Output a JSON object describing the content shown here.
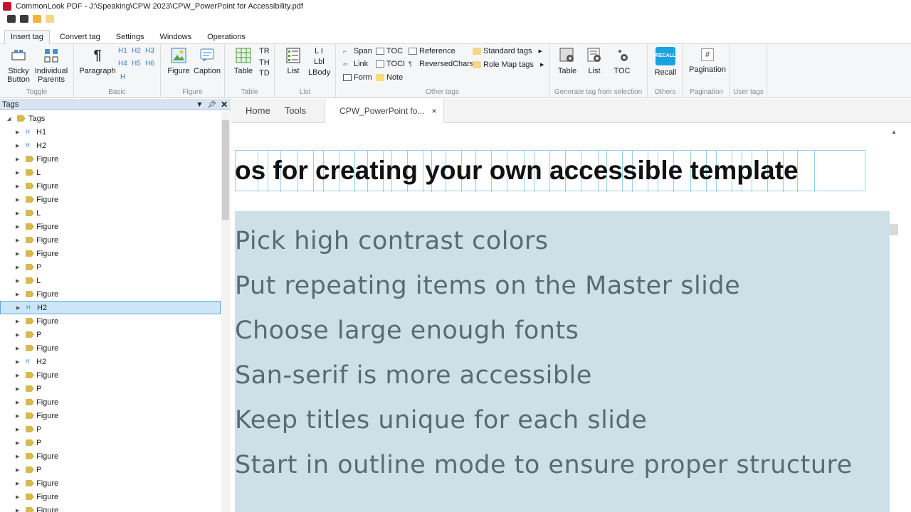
{
  "window": {
    "title": "CommonLook PDF - J:\\Speaking\\CPW 2023\\CPW_PowerPoint for Accessibility.pdf"
  },
  "ribbon_tabs": [
    "Insert tag",
    "Convert tag",
    "Settings",
    "Windows",
    "Operations"
  ],
  "ribbon": {
    "toggle": {
      "label": "Toggle",
      "sticky": "Sticky\nButton",
      "individual": "Individual\nParents"
    },
    "basic": {
      "label": "Basic",
      "paragraph": "Paragraph",
      "h1": "H1",
      "h2": "H2",
      "h3": "H3",
      "h4": "H4",
      "h5": "H5",
      "h6": "H6",
      "h": "H"
    },
    "figure": {
      "label": "Figure",
      "figure": "Figure",
      "caption": "Caption"
    },
    "table": {
      "label": "Table",
      "table": "Table",
      "tr": "TR",
      "th": "TH",
      "td": "TD"
    },
    "list": {
      "label": "List",
      "list": "List",
      "li": "L I",
      "lbl": "Lbl",
      "lbody": "LBody"
    },
    "other": {
      "label": "Other tags",
      "span": "Span",
      "link": "Link",
      "form": "Form",
      "toc": "TOC",
      "toci": "TOCI",
      "note": "Note",
      "reference": "Reference",
      "reversed": "ReversedChars",
      "standard": "Standard tags",
      "rolemap": "Role Map tags"
    },
    "generate": {
      "label": "Generate tag from selection",
      "table": "Table",
      "list": "List",
      "toc": "TOC"
    },
    "others": {
      "label": "Others",
      "recall": "Recall",
      "recall_badge": "RECALL"
    },
    "pagination": {
      "label": "Pagination",
      "pagination": "Pagination",
      "hash": "#"
    },
    "user": {
      "label": "User tags"
    }
  },
  "panel": {
    "title": "Tags",
    "root": "Tags",
    "items": [
      {
        "label": "H1",
        "kind": "h"
      },
      {
        "label": "H2",
        "kind": "h"
      },
      {
        "label": "Figure",
        "kind": "tag"
      },
      {
        "label": "L",
        "kind": "tag"
      },
      {
        "label": "Figure",
        "kind": "tag"
      },
      {
        "label": "Figure",
        "kind": "tag"
      },
      {
        "label": "L",
        "kind": "tag"
      },
      {
        "label": "Figure",
        "kind": "tag"
      },
      {
        "label": "Figure",
        "kind": "tag"
      },
      {
        "label": "Figure",
        "kind": "tag"
      },
      {
        "label": "P",
        "kind": "tag"
      },
      {
        "label": "L",
        "kind": "tag"
      },
      {
        "label": "Figure",
        "kind": "tag"
      },
      {
        "label": "H2",
        "kind": "h",
        "selected": true
      },
      {
        "label": "Figure",
        "kind": "tag"
      },
      {
        "label": "P",
        "kind": "tag"
      },
      {
        "label": "Figure",
        "kind": "tag"
      },
      {
        "label": "H2",
        "kind": "h"
      },
      {
        "label": "Figure",
        "kind": "tag"
      },
      {
        "label": "P",
        "kind": "tag"
      },
      {
        "label": "Figure",
        "kind": "tag"
      },
      {
        "label": "Figure",
        "kind": "tag"
      },
      {
        "label": "P",
        "kind": "tag"
      },
      {
        "label": "P",
        "kind": "tag"
      },
      {
        "label": "Figure",
        "kind": "tag"
      },
      {
        "label": "P",
        "kind": "tag"
      },
      {
        "label": "Figure",
        "kind": "tag"
      },
      {
        "label": "Figure",
        "kind": "tag"
      },
      {
        "label": "Figure",
        "kind": "tag"
      }
    ]
  },
  "doc_tabs": {
    "home": "Home",
    "tools": "Tools",
    "file": "CPW_PowerPoint fo...",
    "close": "×"
  },
  "document": {
    "title": "os for creating your own accessible template",
    "bullets": [
      "Pick high contrast colors",
      "Put repeating items on the Master slide",
      "Choose large enough fonts",
      "San-serif is more accessible",
      "Keep titles unique for each slide",
      "Start in outline mode to ensure proper structure"
    ]
  },
  "colors": {
    "accent": "#2f7fd6",
    "selection": "#cde6f7",
    "slide_bg": "#cde0e8",
    "tag_icon": "#d8b94e",
    "recall": "#1aa3e0"
  }
}
